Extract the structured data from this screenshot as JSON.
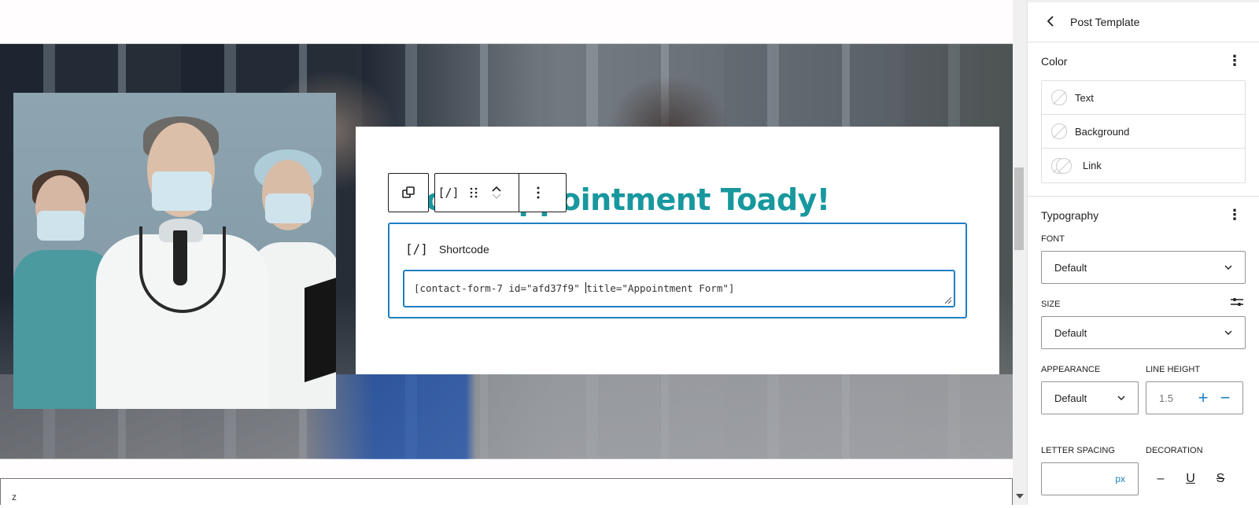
{
  "editor": {
    "heading_text": "ook Appointment Toady!",
    "heading_visible": "tment Toady!",
    "heading_color": "#17989e",
    "accent_color": "#1e7fc2",
    "bottom_field_text": "z"
  },
  "block_toolbar": {
    "parent_icon": "select-parent-icon",
    "block_type_icon": "[/]",
    "drag_icon": "drag-handle-icon",
    "move_up_icon": "chevron-up-icon",
    "move_down_icon": "chevron-down-icon",
    "options_icon": "more-vertical-icon"
  },
  "shortcode_block": {
    "label": "Shortcode",
    "icon": "[/]",
    "value_before_caret": "[contact-form-7 id=\"afd37f9\" ",
    "value_after_caret": "title=\"Appointment Form\"]"
  },
  "sidebar": {
    "back_icon": "chevron-left-icon",
    "title": "Post Template",
    "color_panel": {
      "title": "Color",
      "items": [
        {
          "label": "Text"
        },
        {
          "label": "Background"
        },
        {
          "label": "Link"
        }
      ]
    },
    "typography_panel": {
      "title": "Typography",
      "font_label": "FONT",
      "font_value": "Default",
      "size_label": "SIZE",
      "size_value": "Default",
      "appearance_label": "APPEARANCE",
      "appearance_value": "Default",
      "line_height_label": "LINE HEIGHT",
      "line_height_value": "1.5",
      "letter_spacing_label": "LETTER SPACING",
      "letter_spacing_value": "",
      "letter_spacing_unit": "px",
      "decoration_label": "DECORATION"
    }
  }
}
